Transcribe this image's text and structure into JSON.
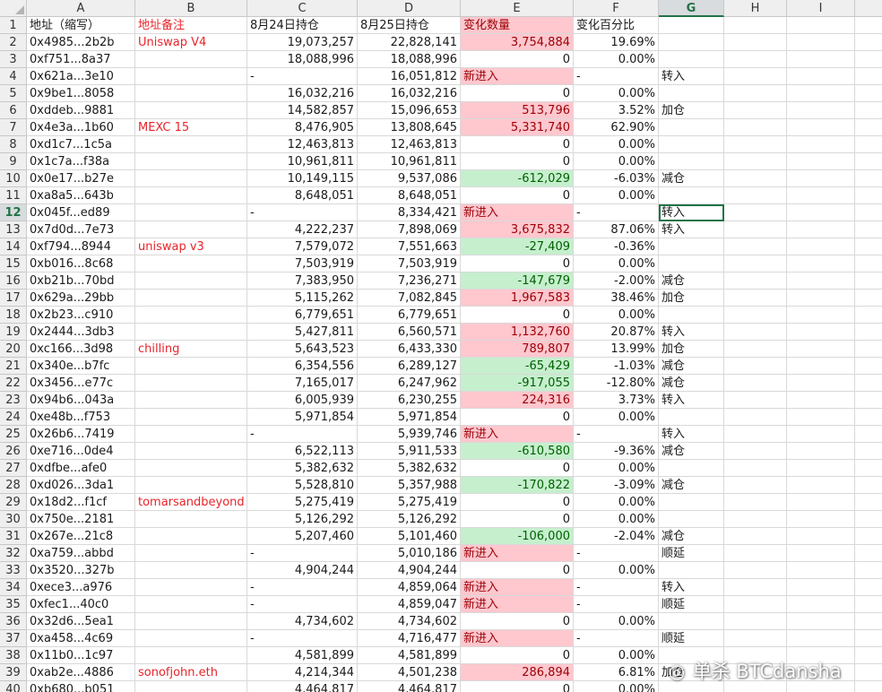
{
  "columns": [
    "A",
    "B",
    "C",
    "D",
    "E",
    "F",
    "G",
    "H",
    "I"
  ],
  "active_cell": "G12",
  "header_row": {
    "rownum": "1",
    "cells": [
      "地址（缩写）",
      "地址备注",
      "8月24日持仓",
      "8月25日持仓",
      "变化数量",
      "变化百分比",
      "",
      "",
      ""
    ]
  },
  "rows": [
    {
      "n": "2",
      "addr": "0x4985...2b2b",
      "note": "Uniswap V4",
      "d24": "19,073,257",
      "d25": "22,828,141",
      "chg": "3,754,884",
      "pct": "19.69%",
      "act": ""
    },
    {
      "n": "3",
      "addr": "0xf751...8a37",
      "note": "",
      "d24": "18,088,996",
      "d25": "18,088,996",
      "chg": "0",
      "pct": "0.00%",
      "act": ""
    },
    {
      "n": "4",
      "addr": "0x621a...3e10",
      "note": "",
      "d24": "-",
      "d25": "16,051,812",
      "chg": "新进入",
      "pct": "-",
      "act": "转入"
    },
    {
      "n": "5",
      "addr": "0x9be1...8058",
      "note": "",
      "d24": "16,032,216",
      "d25": "16,032,216",
      "chg": "0",
      "pct": "0.00%",
      "act": ""
    },
    {
      "n": "6",
      "addr": "0xddeb...9881",
      "note": "",
      "d24": "14,582,857",
      "d25": "15,096,653",
      "chg": "513,796",
      "pct": "3.52%",
      "act": "加仓"
    },
    {
      "n": "7",
      "addr": "0x4e3a...1b60",
      "note": "MEXC 15",
      "d24": "8,476,905",
      "d25": "13,808,645",
      "chg": "5,331,740",
      "pct": "62.90%",
      "act": ""
    },
    {
      "n": "8",
      "addr": "0xd1c7...1c5a",
      "note": "",
      "d24": "12,463,813",
      "d25": "12,463,813",
      "chg": "0",
      "pct": "0.00%",
      "act": ""
    },
    {
      "n": "9",
      "addr": "0x1c7a...f38a",
      "note": "",
      "d24": "10,961,811",
      "d25": "10,961,811",
      "chg": "0",
      "pct": "0.00%",
      "act": ""
    },
    {
      "n": "10",
      "addr": "0x0e17...b27e",
      "note": "",
      "d24": "10,149,115",
      "d25": "9,537,086",
      "chg": "-612,029",
      "pct": "-6.03%",
      "act": "减仓"
    },
    {
      "n": "11",
      "addr": "0xa8a5...643b",
      "note": "",
      "d24": "8,648,051",
      "d25": "8,648,051",
      "chg": "0",
      "pct": "0.00%",
      "act": ""
    },
    {
      "n": "12",
      "addr": "0x045f...ed89",
      "note": "",
      "d24": "-",
      "d25": "8,334,421",
      "chg": "新进入",
      "pct": "-",
      "act": "转入"
    },
    {
      "n": "13",
      "addr": "0x7d0d...7e73",
      "note": "",
      "d24": "4,222,237",
      "d25": "7,898,069",
      "chg": "3,675,832",
      "pct": "87.06%",
      "act": "转入"
    },
    {
      "n": "14",
      "addr": "0xf794...8944",
      "note": "uniswap v3",
      "d24": "7,579,072",
      "d25": "7,551,663",
      "chg": "-27,409",
      "pct": "-0.36%",
      "act": ""
    },
    {
      "n": "15",
      "addr": "0xb016...8c68",
      "note": "",
      "d24": "7,503,919",
      "d25": "7,503,919",
      "chg": "0",
      "pct": "0.00%",
      "act": ""
    },
    {
      "n": "16",
      "addr": "0xb21b...70bd",
      "note": "",
      "d24": "7,383,950",
      "d25": "7,236,271",
      "chg": "-147,679",
      "pct": "-2.00%",
      "act": "减仓"
    },
    {
      "n": "17",
      "addr": "0x629a...29bb",
      "note": "",
      "d24": "5,115,262",
      "d25": "7,082,845",
      "chg": "1,967,583",
      "pct": "38.46%",
      "act": "加仓"
    },
    {
      "n": "18",
      "addr": "0x2b23...c910",
      "note": "",
      "d24": "6,779,651",
      "d25": "6,779,651",
      "chg": "0",
      "pct": "0.00%",
      "act": ""
    },
    {
      "n": "19",
      "addr": "0x2444...3db3",
      "note": "",
      "d24": "5,427,811",
      "d25": "6,560,571",
      "chg": "1,132,760",
      "pct": "20.87%",
      "act": "转入"
    },
    {
      "n": "20",
      "addr": "0xc166...3d98",
      "note": "chilling",
      "d24": "5,643,523",
      "d25": "6,433,330",
      "chg": "789,807",
      "pct": "13.99%",
      "act": "加仓"
    },
    {
      "n": "21",
      "addr": "0x340e...b7fc",
      "note": "",
      "d24": "6,354,556",
      "d25": "6,289,127",
      "chg": "-65,429",
      "pct": "-1.03%",
      "act": "减仓"
    },
    {
      "n": "22",
      "addr": "0x3456...e77c",
      "note": "",
      "d24": "7,165,017",
      "d25": "6,247,962",
      "chg": "-917,055",
      "pct": "-12.80%",
      "act": "减仓"
    },
    {
      "n": "23",
      "addr": "0x94b6...043a",
      "note": "",
      "d24": "6,005,939",
      "d25": "6,230,255",
      "chg": "224,316",
      "pct": "3.73%",
      "act": "转入"
    },
    {
      "n": "24",
      "addr": "0xe48b...f753",
      "note": "",
      "d24": "5,971,854",
      "d25": "5,971,854",
      "chg": "0",
      "pct": "0.00%",
      "act": ""
    },
    {
      "n": "25",
      "addr": "0x26b6...7419",
      "note": "",
      "d24": "-",
      "d25": "5,939,746",
      "chg": "新进入",
      "pct": "-",
      "act": "转入"
    },
    {
      "n": "26",
      "addr": "0xe716...0de4",
      "note": "",
      "d24": "6,522,113",
      "d25": "5,911,533",
      "chg": "-610,580",
      "pct": "-9.36%",
      "act": "减仓"
    },
    {
      "n": "27",
      "addr": "0xdfbe...afe0",
      "note": "",
      "d24": "5,382,632",
      "d25": "5,382,632",
      "chg": "0",
      "pct": "0.00%",
      "act": ""
    },
    {
      "n": "28",
      "addr": "0xd026...3da1",
      "note": "",
      "d24": "5,528,810",
      "d25": "5,357,988",
      "chg": "-170,822",
      "pct": "-3.09%",
      "act": "减仓"
    },
    {
      "n": "29",
      "addr": "0x18d2...f1cf",
      "note": "tomarsandbeyond",
      "d24": "5,275,419",
      "d25": "5,275,419",
      "chg": "0",
      "pct": "0.00%",
      "act": ""
    },
    {
      "n": "30",
      "addr": "0x750e...2181",
      "note": "",
      "d24": "5,126,292",
      "d25": "5,126,292",
      "chg": "0",
      "pct": "0.00%",
      "act": ""
    },
    {
      "n": "31",
      "addr": "0x267e...21c8",
      "note": "",
      "d24": "5,207,460",
      "d25": "5,101,460",
      "chg": "-106,000",
      "pct": "-2.04%",
      "act": "减仓"
    },
    {
      "n": "32",
      "addr": "0xa759...abbd",
      "note": "",
      "d24": "-",
      "d25": "5,010,186",
      "chg": "新进入",
      "pct": "-",
      "act": "顺延"
    },
    {
      "n": "33",
      "addr": "0x3520...327b",
      "note": "",
      "d24": "4,904,244",
      "d25": "4,904,244",
      "chg": "0",
      "pct": "0.00%",
      "act": ""
    },
    {
      "n": "34",
      "addr": "0xece3...a976",
      "note": "",
      "d24": "-",
      "d25": "4,859,064",
      "chg": "新进入",
      "pct": "-",
      "act": "转入"
    },
    {
      "n": "35",
      "addr": "0xfec1...40c0",
      "note": "",
      "d24": "-",
      "d25": "4,859,047",
      "chg": "新进入",
      "pct": "-",
      "act": "顺延"
    },
    {
      "n": "36",
      "addr": "0x32d6...5ea1",
      "note": "",
      "d24": "4,734,602",
      "d25": "4,734,602",
      "chg": "0",
      "pct": "0.00%",
      "act": ""
    },
    {
      "n": "37",
      "addr": "0xa458...4c69",
      "note": "",
      "d24": "-",
      "d25": "4,716,477",
      "chg": "新进入",
      "pct": "-",
      "act": "顺延"
    },
    {
      "n": "38",
      "addr": "0x11b0...1c97",
      "note": "",
      "d24": "4,581,899",
      "d25": "4,581,899",
      "chg": "0",
      "pct": "0.00%",
      "act": ""
    },
    {
      "n": "39",
      "addr": "0xab2e...4886",
      "note": "sonofjohn.eth",
      "d24": "4,214,344",
      "d25": "4,501,238",
      "chg": "286,894",
      "pct": "6.81%",
      "act": "加仓"
    },
    {
      "n": "40",
      "addr": "0xb680...b051",
      "note": "",
      "d24": "4,464,817",
      "d25": "4,464,817",
      "chg": "0",
      "pct": "0.00%",
      "act": ""
    }
  ],
  "watermark": {
    "icon": "weibo-icon",
    "text": "单杀 BTCdansha"
  },
  "colors": {
    "positive_fill": "#ffc7ce",
    "positive_text": "#9c0006",
    "negative_fill": "#c6efce",
    "negative_text": "#006100",
    "note_text": "#e8242a",
    "header_change_fill": "#ffc7ce",
    "selection_border": "#217346"
  }
}
